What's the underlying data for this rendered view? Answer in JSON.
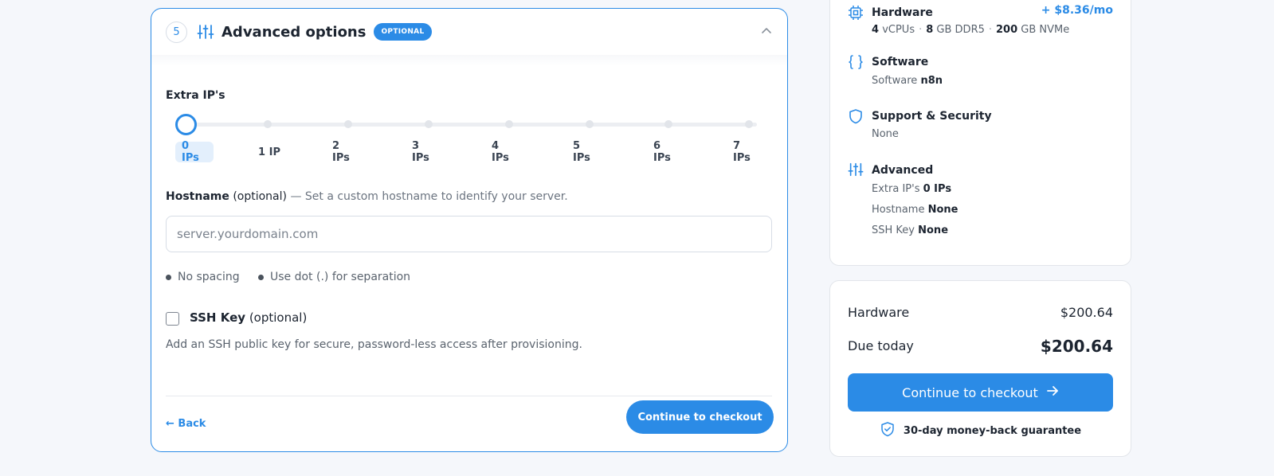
{
  "advanced": {
    "step_number": "5",
    "title": "Advanced options",
    "badge": "OPTIONAL",
    "extra_ips": {
      "label": "Extra IP's",
      "selected_index": 0,
      "options": [
        "0 IPs",
        "1 IP",
        "2 IPs",
        "3 IPs",
        "4 IPs",
        "5 IPs",
        "6 IPs",
        "7 IPs"
      ]
    },
    "hostname": {
      "label": "Hostname",
      "optional": "(optional)",
      "hint": "— Set a custom hostname to identify your server.",
      "placeholder": "server.yourdomain.com",
      "value": "",
      "rules": [
        "No spacing",
        "Use dot (.) for separation"
      ]
    },
    "ssh": {
      "label": "SSH Key",
      "optional": "(optional)",
      "checked": false,
      "description": "Add an SSH public key for secure, password-less access after provisioning."
    },
    "back_label": "← Back",
    "continue_label": "Continue to checkout"
  },
  "summary": {
    "hardware": {
      "title": "Hardware",
      "price": "+ $8.36/mo",
      "cpu_value": "4",
      "cpu_unit": "vCPUs",
      "ram_value": "8",
      "ram_unit": "GB DDR5",
      "disk_value": "200",
      "disk_unit": "GB NVMe"
    },
    "software": {
      "title": "Software",
      "label": "Software",
      "value": "n8n"
    },
    "support": {
      "title": "Support & Security",
      "value": "None"
    },
    "advanced": {
      "title": "Advanced",
      "rows": [
        {
          "label": "Extra IP's",
          "value": "0 IPs"
        },
        {
          "label": "Hostname",
          "value": "None"
        },
        {
          "label": "SSH Key",
          "value": "None"
        }
      ]
    }
  },
  "pricing": {
    "hardware_label": "Hardware",
    "hardware_value": "$200.64",
    "due_label": "Due today",
    "due_value": "$200.64",
    "cta_label": "Continue to checkout",
    "guarantee": "30-day money-back guarantee"
  },
  "colors": {
    "accent": "#2b8be6",
    "text": "#1c2430",
    "muted": "#5a636e",
    "background": "#f5f7fb"
  },
  "icons": {
    "step_section": "sliders-icon",
    "collapse": "chevron-up-icon",
    "hardware": "chip-icon",
    "software": "braces-icon",
    "support": "shield-icon",
    "advanced": "sliders-icon",
    "cta_arrow": "arrow-right-icon",
    "guarantee": "shield-check-icon"
  }
}
